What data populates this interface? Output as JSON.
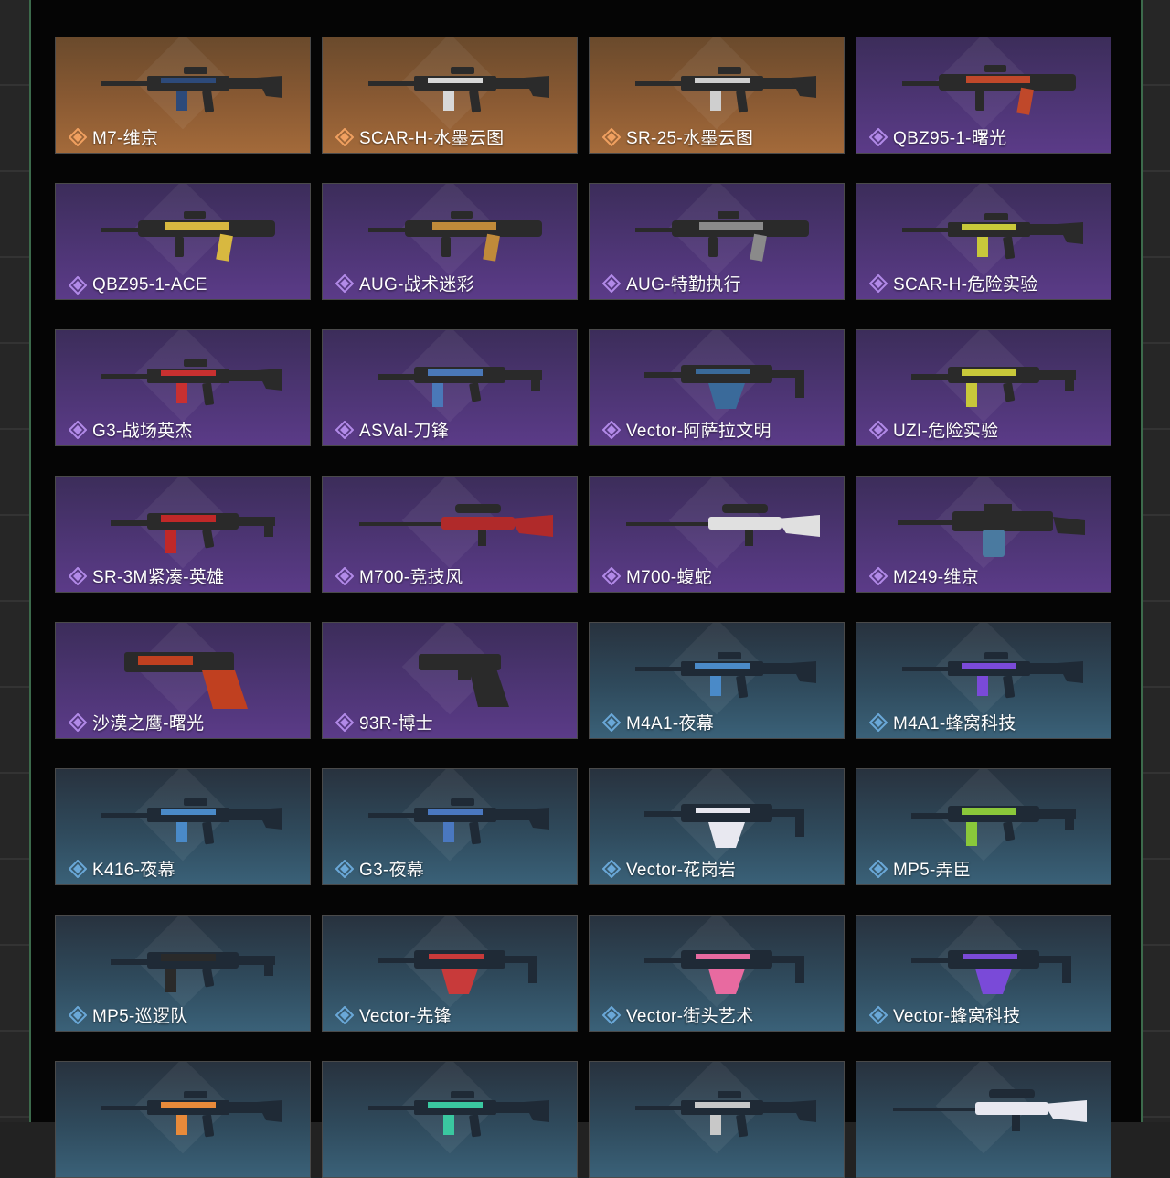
{
  "colors": {
    "orange": "#f0a060",
    "purple": "#b28ae8",
    "blue": "#6aa8d8",
    "body_orange": "#2b2b2b",
    "body_purple": "#2a2a2a",
    "body_blue": "#1f2a36"
  },
  "cards": [
    {
      "label": "M7-维京",
      "tier": "orange",
      "weapon": "rifle",
      "accent": "#2d4a7a"
    },
    {
      "label": "SCAR-H-水墨云图",
      "tier": "orange",
      "weapon": "rifle",
      "accent": "#d8d8d8"
    },
    {
      "label": "SR-25-水墨云图",
      "tier": "orange",
      "weapon": "rifle",
      "accent": "#cfcfcf"
    },
    {
      "label": "QBZ95-1-曙光",
      "tier": "purple",
      "weapon": "bullpup",
      "accent": "#c0482a"
    },
    {
      "label": "QBZ95-1-ACE",
      "tier": "purple",
      "weapon": "bullpup",
      "accent": "#d8b840"
    },
    {
      "label": "AUG-战术迷彩",
      "tier": "purple",
      "weapon": "bullpup",
      "accent": "#c08a3a"
    },
    {
      "label": "AUG-特勤执行",
      "tier": "purple",
      "weapon": "bullpup",
      "accent": "#8a8a8a"
    },
    {
      "label": "SCAR-H-危险实验",
      "tier": "purple",
      "weapon": "rifle",
      "accent": "#c8c83a"
    },
    {
      "label": "G3-战场英杰",
      "tier": "purple",
      "weapon": "rifle",
      "accent": "#c83030"
    },
    {
      "label": "ASVal-刀锋",
      "tier": "purple",
      "weapon": "smg",
      "accent": "#4a78b8"
    },
    {
      "label": "Vector-阿萨拉文明",
      "tier": "purple",
      "weapon": "vector",
      "accent": "#3a6a9a"
    },
    {
      "label": "UZI-危险实验",
      "tier": "purple",
      "weapon": "smg",
      "accent": "#c8c83a"
    },
    {
      "label": "SR-3M紧凑-英雄",
      "tier": "purple",
      "weapon": "smg",
      "accent": "#c02828"
    },
    {
      "label": "M700-竞技风",
      "tier": "purple",
      "weapon": "sniper",
      "accent": "#b02a2a"
    },
    {
      "label": "M700-蝮蛇",
      "tier": "purple",
      "weapon": "sniper",
      "accent": "#e0e0e0"
    },
    {
      "label": "M249-维京",
      "tier": "purple",
      "weapon": "lmg",
      "accent": "#4a7aa0"
    },
    {
      "label": "沙漠之鹰-曙光",
      "tier": "purple",
      "weapon": "pistol_large",
      "accent": "#c04020"
    },
    {
      "label": "93R-博士",
      "tier": "purple",
      "weapon": "pistol",
      "accent": "#333333"
    },
    {
      "label": "M4A1-夜幕",
      "tier": "blue",
      "weapon": "rifle",
      "accent": "#4a8ac8"
    },
    {
      "label": "M4A1-蜂窝科技",
      "tier": "blue",
      "weapon": "rifle",
      "accent": "#7a4ad8"
    },
    {
      "label": "K416-夜幕",
      "tier": "blue",
      "weapon": "rifle",
      "accent": "#4a8ac8"
    },
    {
      "label": "G3-夜幕",
      "tier": "blue",
      "weapon": "rifle",
      "accent": "#4a78c0"
    },
    {
      "label": "Vector-花岗岩",
      "tier": "blue",
      "weapon": "vector",
      "accent": "#e8e8f0"
    },
    {
      "label": "MP5-弄臣",
      "tier": "blue",
      "weapon": "smg",
      "accent": "#8ac83a"
    },
    {
      "label": "MP5-巡逻队",
      "tier": "blue",
      "weapon": "smg",
      "accent": "#2a2a2a"
    },
    {
      "label": "Vector-先锋",
      "tier": "blue",
      "weapon": "vector",
      "accent": "#c83a3a"
    },
    {
      "label": "Vector-街头艺术",
      "tier": "blue",
      "weapon": "vector",
      "accent": "#e86aa0"
    },
    {
      "label": "Vector-蜂窝科技",
      "tier": "blue",
      "weapon": "vector",
      "accent": "#7a4ad8"
    },
    {
      "label": "",
      "tier": "blue",
      "weapon": "rifle",
      "accent": "#e88a3a"
    },
    {
      "label": "",
      "tier": "blue",
      "weapon": "rifle",
      "accent": "#3ac8a0"
    },
    {
      "label": "",
      "tier": "blue",
      "weapon": "rifle",
      "accent": "#c8c8c8"
    },
    {
      "label": "",
      "tier": "blue",
      "weapon": "sniper",
      "accent": "#e8e8f0"
    }
  ]
}
